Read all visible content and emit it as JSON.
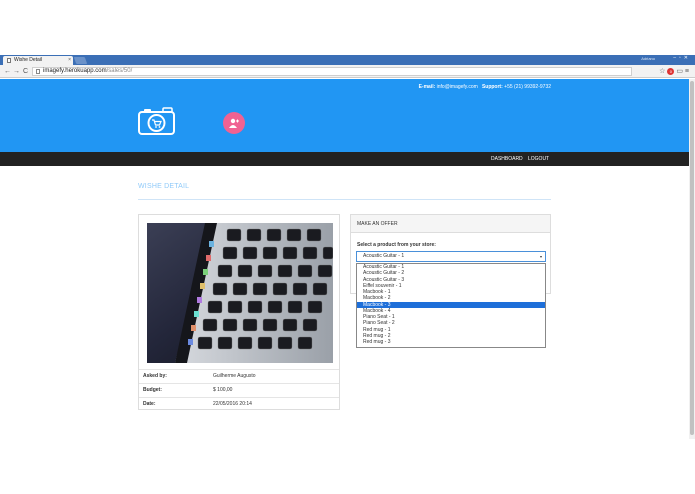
{
  "browser": {
    "tab_title": "Wishe Detail",
    "tab_close": "×",
    "url_domain": "imagefy.herokuapp.com",
    "url_path": "/sales/50/",
    "window_user": "Adriano",
    "window_controls": "–▫✕",
    "nav_back": "←",
    "nav_forward": "→",
    "nav_reload": "C",
    "badge_count": "0"
  },
  "header": {
    "email_label": "E-mail:",
    "email": "info@imagefy.com",
    "support_label": "Support:",
    "support_phone": "+55 (21) 99392-9732"
  },
  "nav": {
    "dashboard": "DASHBOARD",
    "logout": "LOGOUT"
  },
  "page": {
    "title": "WISHE DETAIL"
  },
  "details": {
    "rows": [
      {
        "label": "Asked by:",
        "value": "Guilherme Augusto"
      },
      {
        "label": "Budget:",
        "value": "$ 100,00"
      },
      {
        "label": "Date:",
        "value": "22/05/2016 20:14"
      }
    ]
  },
  "offer": {
    "heading": "MAKE AN OFFER",
    "select_label": "Select a product from your store:",
    "selected_value": "Acoustic Guitar - 1",
    "options": [
      "Acoustic Guitar - 1",
      "Acoustic Guitar - 2",
      "Acoustic Guitar - 3",
      "Eiffel souvenir - 1",
      "Macbook - 1",
      "Macbook - 2",
      "Macbook - 3",
      "Macbook - 4",
      "Piano Seat - 1",
      "Piano Seat - 2",
      "Red mug - 1",
      "Red mug - 2",
      "Red mug - 3"
    ],
    "highlighted_index": 6
  },
  "colors": {
    "brand_blue": "#2196f3",
    "nav_dark": "#222222",
    "accent_pink": "#f06292",
    "highlight": "#1e6fd9"
  }
}
